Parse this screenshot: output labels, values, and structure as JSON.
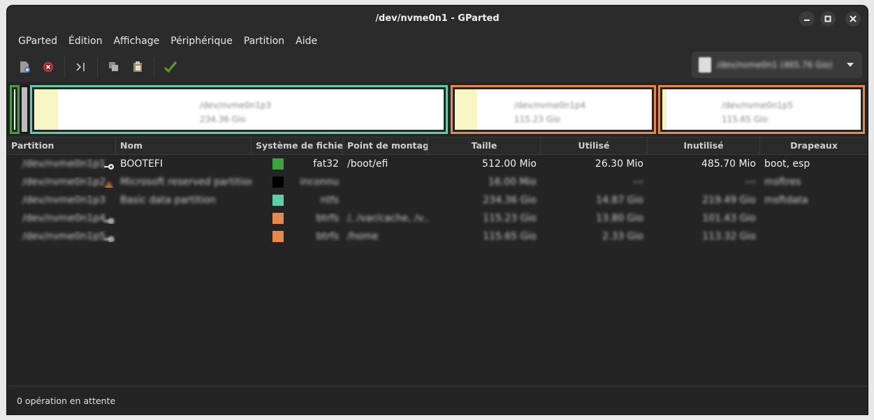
{
  "window": {
    "title": "/dev/nvme0n1 - GParted"
  },
  "menubar": [
    "GParted",
    "Édition",
    "Affichage",
    "Périphérique",
    "Partition",
    "Aide"
  ],
  "device_selector": {
    "label": "/dev/nvme0n1 (465.76 Gio)"
  },
  "disk_map": [
    {
      "name": "/dev/nvme0n1p3",
      "size": "234.36 Gio"
    },
    {
      "name": "/dev/nvme0n1p4",
      "size": "115.23 Gio"
    },
    {
      "name": "/dev/nvme0n1p5",
      "size": "115.65 Gio"
    }
  ],
  "columns": [
    "Partition",
    "Nom",
    "Système de fichiers",
    "Point de montage",
    "Taille",
    "Utilisé",
    "Inutilisé",
    "Drapeaux"
  ],
  "rows": [
    {
      "partition": "/dev/nvme0n1p1",
      "name": "BOOTEFI",
      "fs": "fat32",
      "fs_color": "#3ea33e",
      "mount": "/boot/efi",
      "size": "512.00 Mio",
      "used": "26.30 Mio",
      "unused": "485.70 Mio",
      "flags": "boot, esp",
      "blurred": false,
      "icon": "key-icon"
    },
    {
      "partition": "/dev/nvme0n1p2",
      "name": "Microsoft reserved partition",
      "fs": "inconnu",
      "fs_color": "#000000",
      "mount": "",
      "size": "16.00 Mio",
      "used": "---",
      "unused": "---",
      "flags": "msftres",
      "blurred": true,
      "icon": "warning-icon"
    },
    {
      "partition": "/dev/nvme0n1p3",
      "name": "Basic data partition",
      "fs": "ntfs",
      "fs_color": "#5fcfaa",
      "mount": "",
      "size": "234.36 Gio",
      "used": "14.87 Gio",
      "unused": "219.49 Gio",
      "flags": "msftdata",
      "blurred": true,
      "icon": ""
    },
    {
      "partition": "/dev/nvme0n1p4",
      "name": "",
      "fs": "btrfs",
      "fs_color": "#e8884a",
      "mount": "/, /var/cache, /v...",
      "size": "115.23 Gio",
      "used": "13.80 Gio",
      "unused": "101.43 Gio",
      "flags": "",
      "blurred": true,
      "icon": "key-icon"
    },
    {
      "partition": "/dev/nvme0n1p5",
      "name": "",
      "fs": "btrfs",
      "fs_color": "#e8884a",
      "mount": "/home",
      "size": "115.65 Gio",
      "used": "2.33 Gio",
      "unused": "113.32 Gio",
      "flags": "",
      "blurred": true,
      "icon": "key-icon"
    }
  ],
  "statusbar": {
    "text": "0 opération en attente"
  }
}
